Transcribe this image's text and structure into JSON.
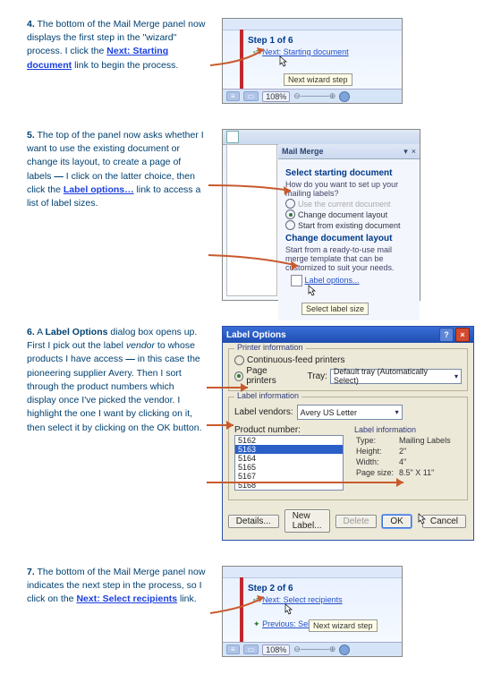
{
  "step4": {
    "num": "4.",
    "text_a": "The bottom of the Mail Merge panel now displays the first step in the \"wizard\" process.  I click the ",
    "link": "Next: Starting document",
    "text_b": " link to begin the process.",
    "shot": {
      "step_label": "Step 1 of 6",
      "next_link": "Next: Starting document",
      "tooltip": "Next wizard step",
      "zoom": "108%",
      "bullet": "➪"
    }
  },
  "step5": {
    "num": "5.",
    "text_a": "The top of the panel now asks whether I want to use the existing document or change its layout, to create a page of labels ",
    "bold_a": "—",
    "text_b": " I click on the latter choice, then click the ",
    "link": "Label options…",
    "text_c": " link to access a list of label sizes.",
    "panel": {
      "title": "Mail Merge",
      "sect1": "Select starting document",
      "q": "How do you want to set up your mailing labels?",
      "opt1": "Use the current document",
      "opt2": "Change document layout",
      "opt3": "Start from existing document",
      "sect2": "Change document layout",
      "desc": "Start from a ready-to-use mail merge template that can be customized to suit your needs.",
      "link": "Label options...",
      "tooltip": "Select label size"
    }
  },
  "step6": {
    "num": "6.",
    "text_a": "A ",
    "bold_a": "Label Options",
    "text_b": " dialog box opens up.  First I pick out the label ",
    "ital_a": "vendor",
    "text_c": " to whose products I have access ",
    "bold_b": "—",
    "text_d": " in this case the pioneering supplier Avery.  Then I sort through the product numbers which display once I've picked the vendor.  I highlight the one I want by clicking on it, then select it by clicking on the OK button.",
    "dialog": {
      "title": "Label Options",
      "grp_printer": "Printer information",
      "opt_cont": "Continuous-feed printers",
      "opt_page": "Page printers",
      "tray_lbl": "Tray:",
      "tray_val": "Default tray (Automatically Select)",
      "grp_labelinfo_top": "Label information",
      "vendors_lbl": "Label vendors:",
      "vendors_val": "Avery US Letter",
      "prod_lbl": "Product number:",
      "products": [
        "5162",
        "5163",
        "5164",
        "5165",
        "5167",
        "5168"
      ],
      "sel_product_index": 1,
      "info_title": "Label information",
      "info_type_l": "Type:",
      "info_type_v": "Mailing Labels",
      "info_h_l": "Height:",
      "info_h_v": "2\"",
      "info_w_l": "Width:",
      "info_w_v": "4\"",
      "info_ps_l": "Page size:",
      "info_ps_v": "8.5\" X 11\"",
      "btn_details": "Details...",
      "btn_new": "New Label...",
      "btn_del": "Delete",
      "btn_ok": "OK",
      "btn_cancel": "Cancel"
    }
  },
  "step7": {
    "num": "7.",
    "text_a": "The bottom of the Mail Merge panel now indicates the next step in the process, so I click on the ",
    "link": "Next: Select recipients",
    "text_b": " link.",
    "shot": {
      "step_label": "Step 2 of 6",
      "next_link": "Next: Select recipients",
      "prev_prefix": "Previous: ",
      "prev_link": "Select document type",
      "tooltip": "Next wizard step",
      "zoom": "108%",
      "bullet": "➪",
      "prev_glyph": "✦"
    }
  }
}
